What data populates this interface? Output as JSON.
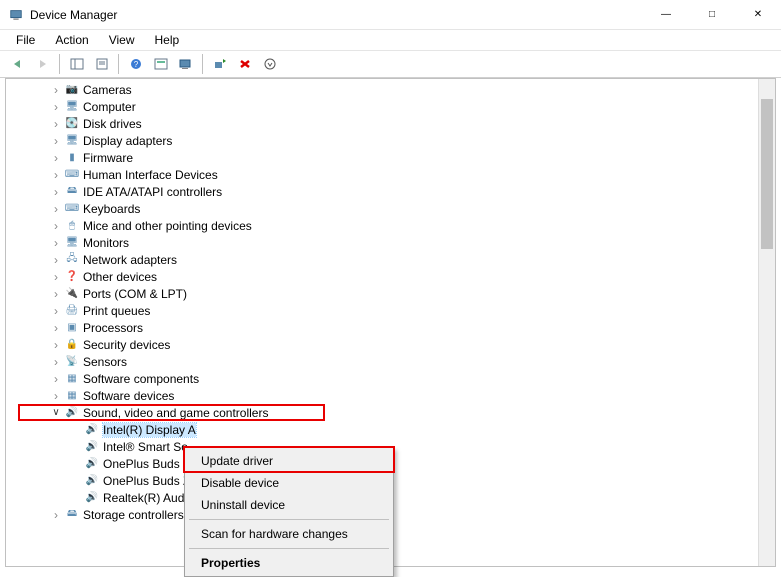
{
  "window": {
    "title": "Device Manager"
  },
  "menubar": [
    "File",
    "Action",
    "View",
    "Help"
  ],
  "toolbar": [
    {
      "name": "back-button",
      "glyph": "⬅"
    },
    {
      "name": "forward-button",
      "glyph": "➡"
    },
    {
      "name": "show-hide-tree-button",
      "glyph": "📋"
    },
    {
      "name": "properties-button",
      "glyph": "📄"
    },
    {
      "name": "help-button",
      "glyph": "?"
    },
    {
      "name": "update-button",
      "glyph": "🗔"
    },
    {
      "name": "scan-hardware-button",
      "glyph": "🖥"
    },
    {
      "name": "add-legacy-button",
      "glyph": "➕"
    },
    {
      "name": "uninstall-button",
      "glyph": "✖"
    },
    {
      "name": "action-button",
      "glyph": "⬇"
    }
  ],
  "categories": [
    {
      "label": "Cameras",
      "icon": "📷"
    },
    {
      "label": "Computer",
      "icon": "🖥"
    },
    {
      "label": "Disk drives",
      "icon": "💽"
    },
    {
      "label": "Display adapters",
      "icon": "🖥"
    },
    {
      "label": "Firmware",
      "icon": "▮"
    },
    {
      "label": "Human Interface Devices",
      "icon": "⌨"
    },
    {
      "label": "IDE ATA/ATAPI controllers",
      "icon": "🖴"
    },
    {
      "label": "Keyboards",
      "icon": "⌨"
    },
    {
      "label": "Mice and other pointing devices",
      "icon": "🖱"
    },
    {
      "label": "Monitors",
      "icon": "🖥"
    },
    {
      "label": "Network adapters",
      "icon": "🖧"
    },
    {
      "label": "Other devices",
      "icon": "❓"
    },
    {
      "label": "Ports (COM & LPT)",
      "icon": "🔌"
    },
    {
      "label": "Print queues",
      "icon": "🖨"
    },
    {
      "label": "Processors",
      "icon": "▣"
    },
    {
      "label": "Security devices",
      "icon": "🔒"
    },
    {
      "label": "Sensors",
      "icon": "📡"
    },
    {
      "label": "Software components",
      "icon": "▦"
    },
    {
      "label": "Software devices",
      "icon": "▦"
    }
  ],
  "open_category": {
    "label": "Sound, video and game controllers",
    "icon": "🔊",
    "children": [
      {
        "label": "Intel(R) Display Audio",
        "selected": true
      },
      {
        "label": "Intel® Smart Sound Technology"
      },
      {
        "label": "OnePlus Buds Z"
      },
      {
        "label": "OnePlus Buds Z"
      },
      {
        "label": "Realtek(R) Audio"
      }
    ]
  },
  "tail_category": {
    "label": "Storage controllers",
    "icon": "🖴"
  },
  "context_menu": {
    "items": [
      {
        "label": "Update driver",
        "highlight": true
      },
      {
        "label": "Disable device"
      },
      {
        "label": "Uninstall device"
      },
      {
        "sep": true
      },
      {
        "label": "Scan for hardware changes"
      },
      {
        "sep": true
      },
      {
        "label": "Properties",
        "bold": true
      }
    ]
  }
}
